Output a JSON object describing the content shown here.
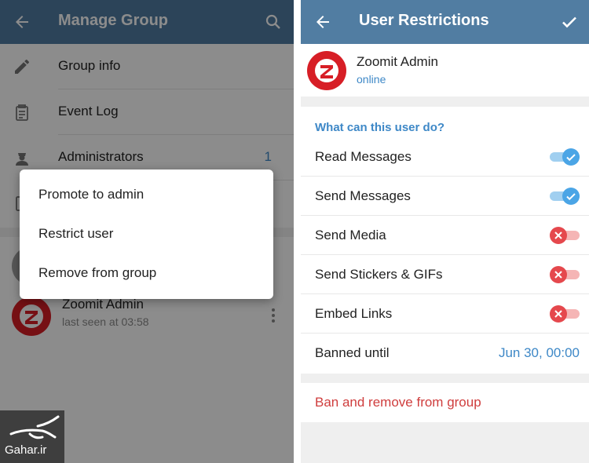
{
  "left": {
    "title": "Manage Group",
    "menu": [
      {
        "label": "Group info",
        "icon": "pencil-icon"
      },
      {
        "label": "Event Log",
        "icon": "clipboard-icon"
      },
      {
        "label": "Administrators",
        "icon": "admin-icon",
        "count": "1"
      }
    ],
    "member": {
      "name": "Zoomit Admin",
      "status": "last seen at 03:58"
    },
    "popup": [
      "Promote to admin",
      "Restrict user",
      "Remove from group"
    ],
    "watermark": "Gahar.ir"
  },
  "right": {
    "title": "User Restrictions",
    "user": {
      "name": "Zoomit Admin",
      "status": "online"
    },
    "section_header": "What can this user do?",
    "permissions": [
      {
        "label": "Read Messages",
        "enabled": true
      },
      {
        "label": "Send Messages",
        "enabled": true
      },
      {
        "label": "Send Media",
        "enabled": false
      },
      {
        "label": "Send Stickers & GIFs",
        "enabled": false
      },
      {
        "label": "Embed Links",
        "enabled": false
      }
    ],
    "banned_until": {
      "label": "Banned until",
      "value": "Jun 30, 00:00"
    },
    "ban_action": "Ban and remove from group"
  },
  "colors": {
    "appbar": "#517da2",
    "accent": "#3e88c7",
    "toggle_on": "#4ba5e6",
    "toggle_off": "#e5484d",
    "danger": "#cf3d3d",
    "brand": "#d71e26"
  }
}
